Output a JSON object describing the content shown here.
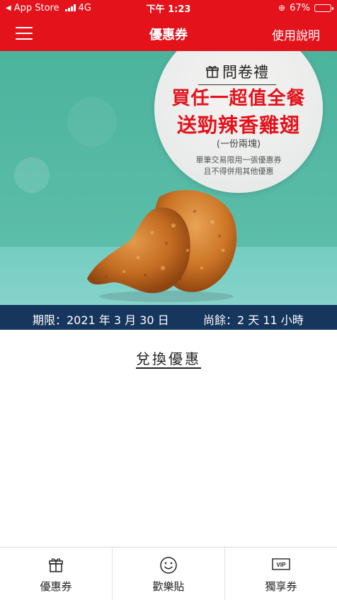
{
  "status_bar": {
    "back_app": "App Store",
    "network": "4G",
    "time": "下午 1:23",
    "battery": "67%",
    "battery_level": 0.67
  },
  "navbar": {
    "title": "優惠券",
    "help_label": "使用說明",
    "menu_icon": "hamburger-menu-icon"
  },
  "promo": {
    "tag": "問卷禮",
    "tag_icon": "gift-icon",
    "headline_1": "買任一超值全餐",
    "headline_2": "送勁辣香雞翅",
    "portion": "(一份兩塊)",
    "terms_1": "單筆交易限用一張優惠券",
    "terms_2": "且不得併用其他優惠"
  },
  "expiry": {
    "deadline": "期限：2021 年 3 月 30 日",
    "remaining": "尚餘：2 天 11 小時"
  },
  "redeem_label": "兌換優惠",
  "tabs": [
    {
      "label": "優惠券",
      "icon": "gift-icon"
    },
    {
      "label": "歡樂貼",
      "icon": "smiley-icon"
    },
    {
      "label": "獨享券",
      "icon": "vip-icon",
      "icon_text": "VIP"
    }
  ],
  "colors": {
    "brand_red": "#e3121b",
    "expiry_bar": "#17365e",
    "teal_bg": "#4cb39d"
  }
}
